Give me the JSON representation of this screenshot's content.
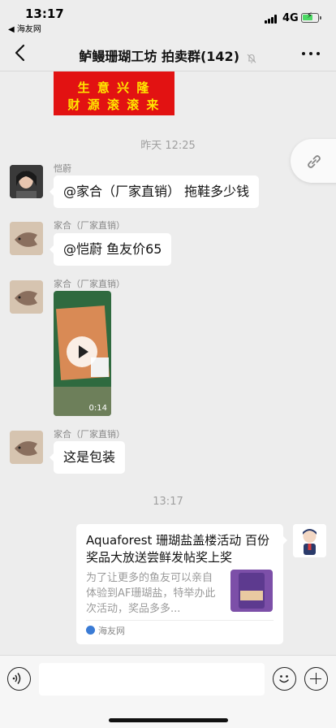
{
  "status_bar": {
    "time": "13:17",
    "back_app": "◀ 海友网",
    "network": "4G",
    "icons": [
      "signal-icon",
      "battery-charging-icon"
    ]
  },
  "nav": {
    "title": "鲈鳗珊瑚工坊 拍卖群(142)",
    "icons": [
      "back-icon",
      "mute-icon",
      "more-icon"
    ]
  },
  "chat": {
    "promo_image": {
      "line1": "生 意 兴 隆",
      "line2": "财 源 滚 滚 来"
    },
    "timestamps": [
      "昨天 12:25",
      "13:17"
    ],
    "messages": [
      {
        "sender": "恺蔚",
        "text": "@家合（厂家直销） 拖鞋多少钱"
      },
      {
        "sender": "家合（厂家直销）",
        "text": "@恺蔚 鱼友价65"
      },
      {
        "sender": "家合（厂家直销）",
        "video_duration": "0:14"
      },
      {
        "sender": "家合（厂家直销）",
        "text": "这是包装"
      }
    ],
    "link_card": {
      "title": "Aquaforest 珊瑚盐盖楼活动 百份奖品大放送尝鲜发帖奖上奖",
      "description": "为了让更多的鱼友可以亲自体验到AF珊瑚盐，特举办此次活动，奖品多多...",
      "source": "海友网"
    }
  },
  "input_bar": {
    "icons": [
      "voice-icon",
      "emoji-icon",
      "plus-icon"
    ]
  }
}
